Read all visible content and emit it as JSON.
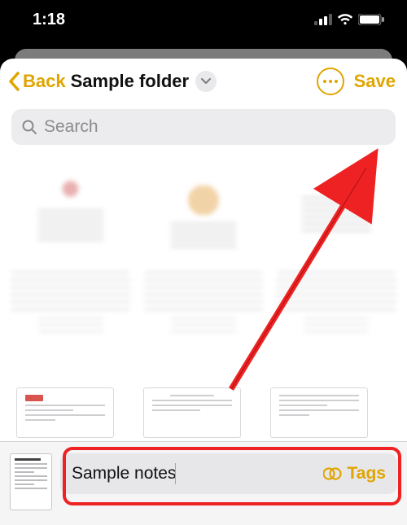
{
  "status": {
    "time": "1:18"
  },
  "nav": {
    "back_label": "Back",
    "title": "Sample folder",
    "save_label": "Save"
  },
  "search": {
    "placeholder": "Search"
  },
  "note": {
    "name": "Sample notes",
    "tags_label": "Tags"
  },
  "colors": {
    "accent": "#e0a500",
    "highlight": "#e22"
  }
}
